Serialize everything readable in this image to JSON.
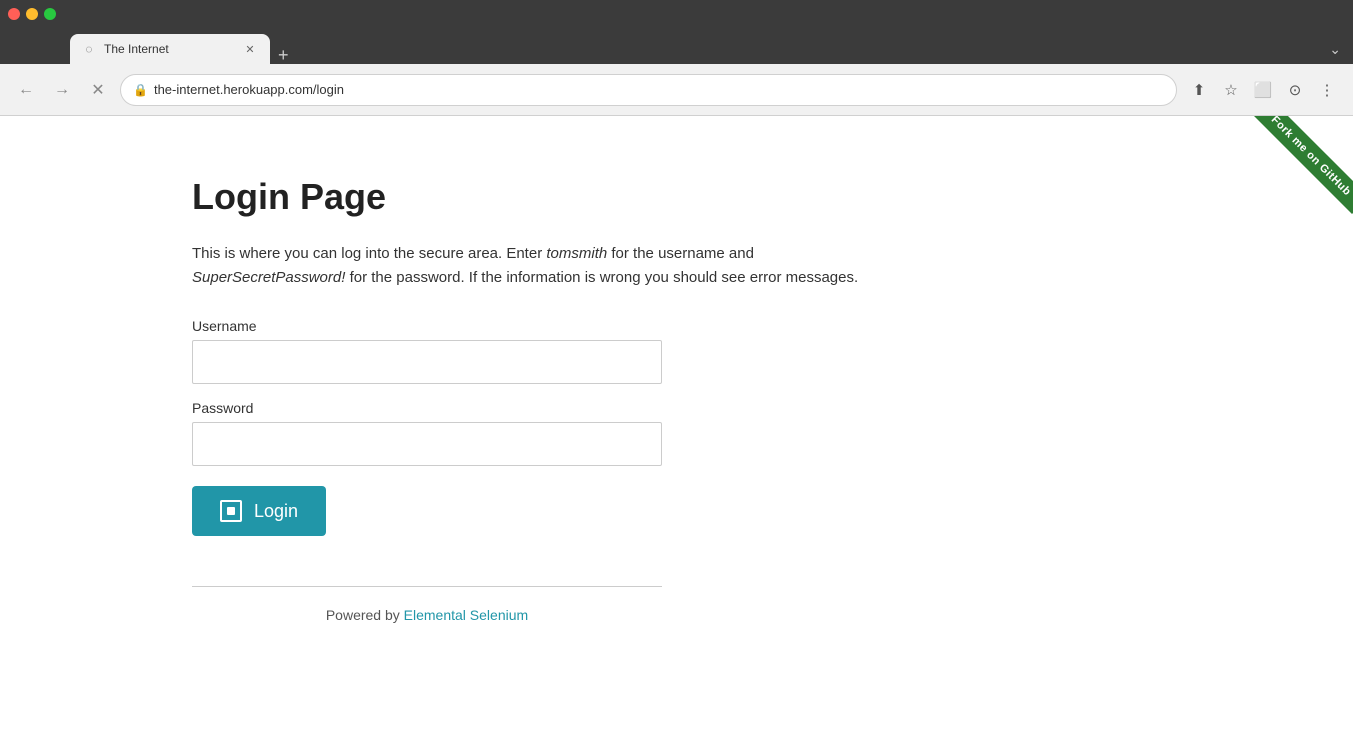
{
  "browser": {
    "tab_title": "The Internet",
    "url": "the-internet.herokuapp.com/login",
    "nav": {
      "back_label": "←",
      "forward_label": "→",
      "close_label": "✕"
    },
    "toolbar_icons": {
      "share": "⬆",
      "bookmark": "☆",
      "sidebar": "⬜",
      "profile": "⊙",
      "menu": "⋮",
      "chevron": "⌄"
    }
  },
  "page": {
    "heading": "Login Page",
    "description_plain": "This is where you can log into the secure area. Enter ",
    "description_username": "tomsmith",
    "description_middle": " for the username and ",
    "description_password": "SuperSecretPassword!",
    "description_end": " for the password. If the information is wrong you should see error messages.",
    "username_label": "Username",
    "password_label": "Password",
    "login_button": "Login",
    "footer_text": "Powered by ",
    "footer_link": "Elemental Selenium",
    "fork_ribbon": "Fork me on GitHub"
  }
}
